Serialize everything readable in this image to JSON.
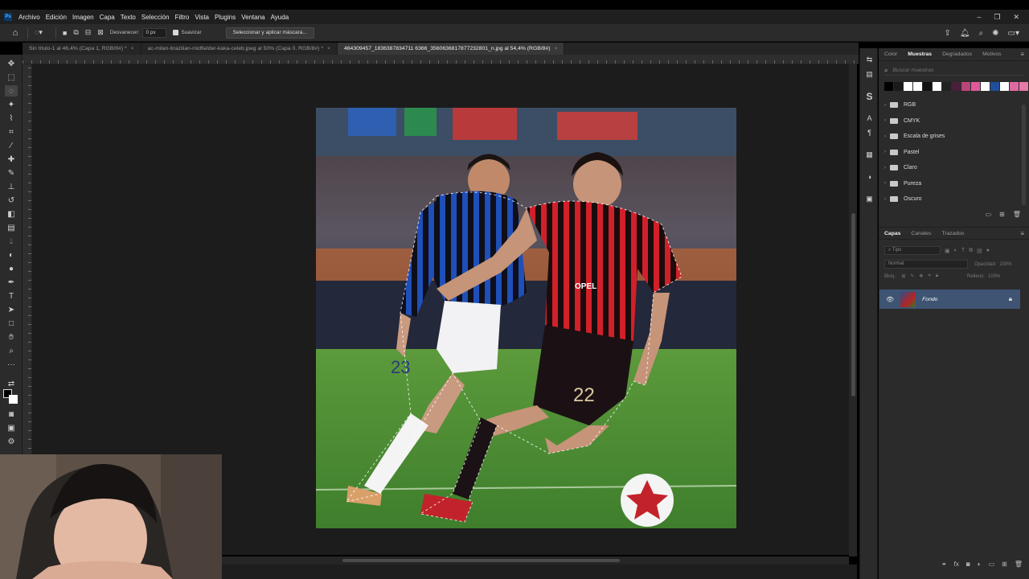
{
  "app": {
    "logo": "Ps"
  },
  "menu": [
    "Archivo",
    "Edición",
    "Imagen",
    "Capa",
    "Texto",
    "Selección",
    "Filtro",
    "Vista",
    "Plugins",
    "Ventana",
    "Ayuda"
  ],
  "options": {
    "feather_label": "Desvanecer:",
    "feather_value": "0 px",
    "smooth_label": "Suavizar",
    "mask_button": "Seleccionar y aplicar máscara..."
  },
  "tabs": [
    {
      "label": "Sin título-1 al 46,4% (Capa 1, RGB/8#) *",
      "active": false
    },
    {
      "label": "ac-milan-brazilian-midfielder-kaka-celeb.jpeg al 50% (Capa 0, RGB/8#) *",
      "active": false
    },
    {
      "label": "464309457_1836387834711 6366_3560636817877232801_n.jpg al 54,4% (RGB/8#)",
      "active": true
    }
  ],
  "panel": {
    "tabs": [
      "Color",
      "Muestras",
      "Degradados",
      "Motivos"
    ],
    "active_tab": "Muestras",
    "search_placeholder": "Buscar muestras",
    "swatches": [
      "#000000",
      "#1a1a1a",
      "#ffffff",
      "#ffffff",
      "#111111",
      "#ffffff",
      "#222222",
      "#4a1f3a",
      "#b8457a",
      "#e05a9a",
      "#ffffff",
      "#1f4f9a",
      "#ffffff",
      "#e06aa0",
      "#e67aa8"
    ],
    "folders": [
      "RGB",
      "CMYK",
      "Escala de grises",
      "Pastel",
      "Claro",
      "Pureza",
      "Oscuro"
    ]
  },
  "layers": {
    "tabs": [
      "Capas",
      "Canales",
      "Trazados"
    ],
    "active_tab": "Capas",
    "filter_label": "Tipo",
    "blend_mode": "Normal",
    "opacity_label": "Opacidad:",
    "opacity_value": "100%",
    "lock_label": "Bloq.:",
    "fill_label": "Relleno:",
    "fill_value": "100%",
    "items": [
      {
        "name": "Fondo",
        "locked": true
      }
    ]
  }
}
